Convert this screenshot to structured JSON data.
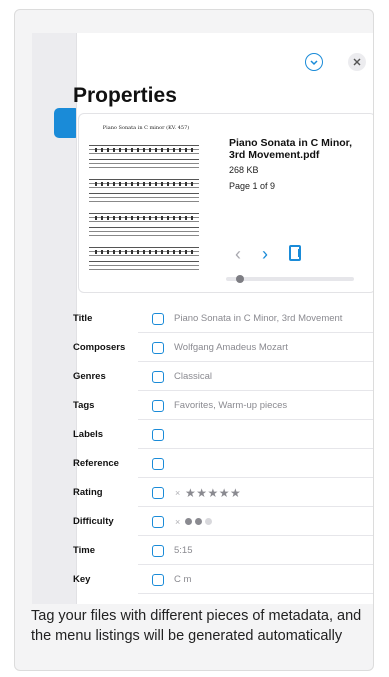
{
  "panel": {
    "title": "Properties",
    "file": {
      "name": "Piano Sonata in C Minor, 3rd Movement.pdf",
      "size": "268 KB",
      "page_info": "Page 1 of 9",
      "thumbnail_title": "Piano Sonata in C minor (KV. 457)",
      "page_scrubber_position": 0.08
    }
  },
  "fields": [
    {
      "label": "Title",
      "value": "Piano Sonata in C Minor, 3rd Movement"
    },
    {
      "label": "Composers",
      "value": "Wolfgang Amadeus Mozart"
    },
    {
      "label": "Genres",
      "value": "Classical"
    },
    {
      "label": "Tags",
      "value": "Favorites, Warm-up pieces"
    },
    {
      "label": "Labels",
      "value": ""
    },
    {
      "label": "Reference",
      "value": ""
    },
    {
      "label": "Rating",
      "value": "",
      "stars": "★★★★★",
      "clear": "×"
    },
    {
      "label": "Difficulty",
      "value": "",
      "difficulty_level": 2,
      "difficulty_max": 3,
      "clear": "×"
    },
    {
      "label": "Time",
      "value": "5:15"
    },
    {
      "label": "Key",
      "value": "C m"
    }
  ],
  "icons": [
    "check-circle-icon",
    "close-icon",
    "chevron-left-icon",
    "chevron-right-icon",
    "book-icon"
  ],
  "colors": {
    "accent": "#1a8bd8",
    "secondary_text": "#8a8a90"
  },
  "caption": "Tag your files with different pieces of metadata, and the menu listings will be generated automatically"
}
